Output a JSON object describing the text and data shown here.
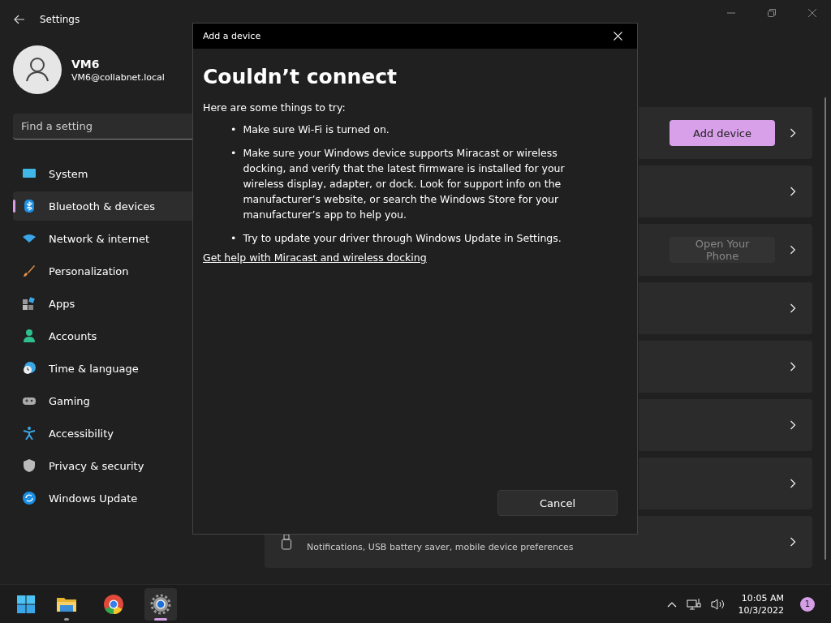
{
  "window": {
    "title": "Settings"
  },
  "user": {
    "name": "VM6",
    "email": "VM6@collabnet.local"
  },
  "search": {
    "placeholder": "Find a setting"
  },
  "nav": [
    {
      "label": "System",
      "selected": false
    },
    {
      "label": "Bluetooth & devices",
      "selected": true
    },
    {
      "label": "Network & internet",
      "selected": false
    },
    {
      "label": "Personalization",
      "selected": false
    },
    {
      "label": "Apps",
      "selected": false
    },
    {
      "label": "Accounts",
      "selected": false
    },
    {
      "label": "Time & language",
      "selected": false
    },
    {
      "label": "Gaming",
      "selected": false
    },
    {
      "label": "Accessibility",
      "selected": false
    },
    {
      "label": "Privacy & security",
      "selected": false
    },
    {
      "label": "Windows Update",
      "selected": false
    }
  ],
  "cards": [
    {
      "kind": "button",
      "button": {
        "label": "Add device",
        "disabled": false
      }
    },
    {
      "kind": "link"
    },
    {
      "kind": "button",
      "button": {
        "label": "Open Your Phone",
        "disabled": true
      }
    },
    {
      "kind": "link"
    },
    {
      "kind": "link"
    },
    {
      "kind": "link"
    },
    {
      "kind": "link"
    },
    {
      "kind": "usb",
      "subtitle": "Notifications, USB battery saver, mobile device preferences"
    }
  ],
  "dialog": {
    "title": "Add a device",
    "heading": "Couldn’t connect",
    "intro": "Here are some things to try:",
    "bullets": [
      {
        "marker": "•",
        "text": "Make sure Wi-Fi is turned on."
      },
      {
        "marker": "•",
        "text": "Make sure your Windows device supports Miracast or wireless docking, and verify that the latest firmware is installed for your wireless display, adapter, or dock. Look for support info on the manufacturer’s website, or search the Windows Store for your manufacturer’s app to help you."
      },
      {
        "marker": "•",
        "text": "Try to update your driver through Windows Update in Settings."
      }
    ],
    "link": "Get help with Miracast and wireless docking",
    "cancel": "Cancel"
  },
  "taskbar": {
    "time": "10:05 AM",
    "date": "10/3/2022",
    "notifications": "1",
    "apps": [
      {
        "active": false,
        "running": true
      },
      {
        "active": false,
        "running": false
      },
      {
        "active": true,
        "running": true
      }
    ]
  }
}
